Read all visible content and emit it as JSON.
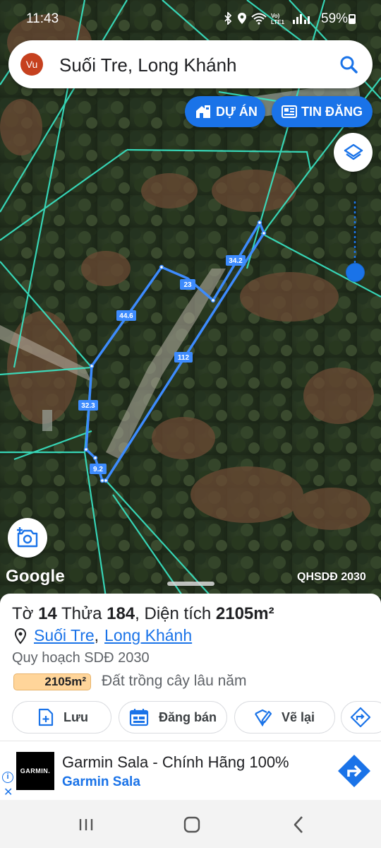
{
  "status_bar": {
    "time": "11:43",
    "battery": "59%",
    "network_label": "Vo) LTE1"
  },
  "search": {
    "avatar_initials": "Vu",
    "query": "Suối Tre, Long Khánh"
  },
  "map_buttons": {
    "du_an": "DỰ ÁN",
    "tin_dang": "TIN ĐĂNG"
  },
  "map": {
    "attribution": "Google",
    "layer_label": "QHSDĐ 2030",
    "parcel_edges": [
      "34.2",
      "23",
      "44.6",
      "112",
      "32.3",
      "9.2"
    ],
    "colors": {
      "parcel_outline": "#3d8bfd",
      "boundaries": "#39e6c6",
      "accent": "#1a73e8"
    }
  },
  "parcel": {
    "title_prefix": "Tờ",
    "sheet_no": "14",
    "plot_label": "Thửa",
    "plot_no": "184",
    "area_label": ", Diện tích",
    "area": "2105m²",
    "ward": "Suối Tre",
    "separator": ",",
    "city": "Long Khánh",
    "plan_title": "Quy hoạch SDĐ 2030",
    "land_area": "2105m²",
    "land_use": "Đất trồng cây lâu năm"
  },
  "actions": {
    "save": "Lưu",
    "sell": "Đăng bán",
    "redraw": "Vẽ lại"
  },
  "ad": {
    "logo": "GARMIN.",
    "headline": "Garmin Sala - Chính Hãng 100%",
    "advertiser": "Garmin Sala"
  }
}
